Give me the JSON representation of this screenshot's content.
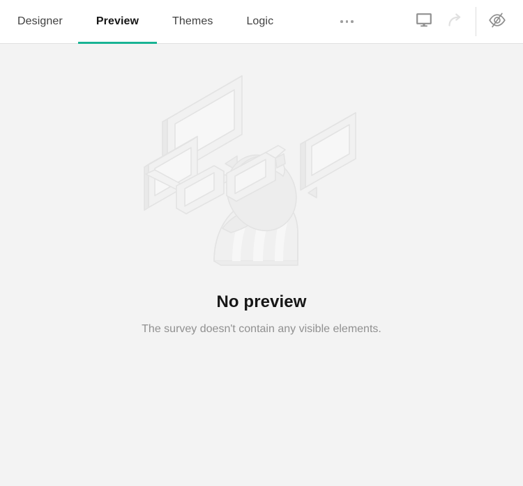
{
  "tabbar": {
    "tabs": [
      {
        "label": "Designer",
        "active": false
      },
      {
        "label": "Preview",
        "active": true
      },
      {
        "label": "Themes",
        "active": false
      },
      {
        "label": "Logic",
        "active": false
      }
    ],
    "more_menu": {
      "icon": "ellipsis-icon",
      "label": "•••"
    },
    "active_tab_indicator_color": "#19b394",
    "tools": [
      {
        "name": "device-preview-icon",
        "title": "Desktop",
        "state": "enabled"
      },
      {
        "name": "redo-arrow-icon",
        "title": "Redo",
        "state": "disabled"
      },
      {
        "name": "eye-slash-icon",
        "title": "Hide invisible elements",
        "state": "enabled"
      }
    ]
  },
  "empty_state": {
    "illustration": "no-preview-illustration",
    "title": "No preview",
    "subtitle": "The survey doesn't contain any visible elements."
  },
  "colors": {
    "accent": "#19b394",
    "page_background": "#f3f3f3",
    "bar_background": "#ffffff",
    "title_text": "#161616",
    "muted_text": "#909090",
    "tab_text": "#404040",
    "illustration_stroke": "#e2e2e2",
    "illustration_fill": "#eeeeee"
  }
}
